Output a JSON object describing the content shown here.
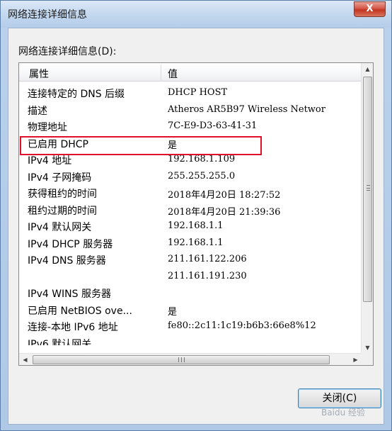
{
  "window": {
    "title": "网络连接详细信息",
    "close_glyph": "X"
  },
  "group_label": "网络连接详细信息(D):",
  "list": {
    "columns": [
      "属性",
      "值"
    ],
    "rows": [
      {
        "property": "连接特定的 DNS 后缀",
        "value": "DHCP HOST"
      },
      {
        "property": "描述",
        "value": "Atheros AR5B97 Wireless Networ"
      },
      {
        "property": "物理地址",
        "value": "7C-E9-D3-63-41-31"
      },
      {
        "property": "已启用 DHCP",
        "value": "是"
      },
      {
        "property": "IPv4 地址",
        "value": "192.168.1.109"
      },
      {
        "property": "IPv4 子网掩码",
        "value": "255.255.255.0"
      },
      {
        "property": "获得租约的时间",
        "value": "2018年4月20日 18:27:52"
      },
      {
        "property": "租约过期的时间",
        "value": "2018年4月20日 21:39:36"
      },
      {
        "property": "IPv4 默认网关",
        "value": "192.168.1.1"
      },
      {
        "property": "IPv4 DHCP 服务器",
        "value": "192.168.1.1"
      },
      {
        "property": "IPv4 DNS 服务器",
        "value": "211.161.122.206"
      },
      {
        "property": "",
        "value": "211.161.191.230"
      },
      {
        "property": "IPv4 WINS 服务器",
        "value": ""
      },
      {
        "property": "已启用 NetBIOS ove...",
        "value": "是"
      },
      {
        "property": "连接-本地 IPv6 地址",
        "value": "fe80::2c11:1c19:b6b3:66e8%12"
      },
      {
        "property": "IPv6 默认网关",
        "value": ""
      }
    ]
  },
  "buttons": {
    "close_label": "关闭(C)"
  },
  "watermark": "Baidu 经验"
}
